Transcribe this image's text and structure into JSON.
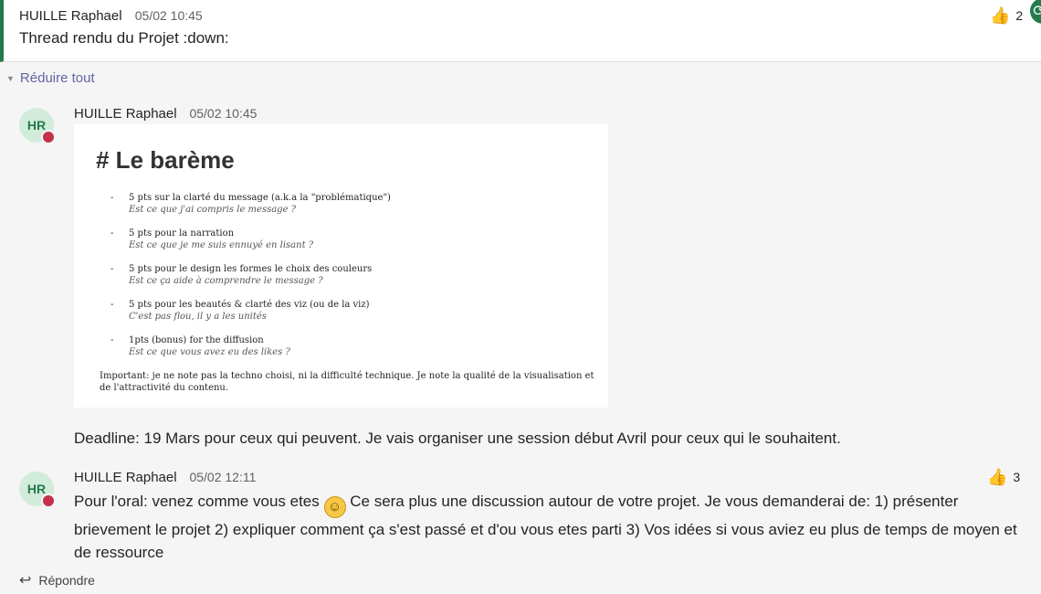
{
  "top_post": {
    "author": "HUILLE Raphael",
    "time": "05/02 10:45",
    "message": "Thread rendu du Projet :down:",
    "reaction_count": "2"
  },
  "collapse_label": "Réduire tout",
  "reply1": {
    "avatar_initials": "HR",
    "author": "HUILLE Raphael",
    "time": "05/02 10:45",
    "image": {
      "title": "# Le barème",
      "items": [
        {
          "main": "5 pts sur la clarté du message (a.k.a la \"problématique\")",
          "sub": "Est ce que j'ai compris le message ?"
        },
        {
          "main": "5 pts  pour la narration",
          "sub": "Est ce que je me suis ennuyé en lisant ?"
        },
        {
          "main": "5 pts pour le design les formes le choix des couleurs",
          "sub": "Est ce ça aide à comprendre le message ?"
        },
        {
          "main": "5 pts pour les beautés & clarté des viz (ou de la viz)",
          "sub": "C'est pas flou, il y a les unités"
        },
        {
          "main": "1pts (bonus) for the diffusion",
          "sub": "Est ce que vous avez eu des likes ?"
        }
      ],
      "note": "Important: je ne note pas la techno choisi, ni la difficulté technique. Je note la qualité de la visualisation et de l'attractivité du contenu."
    },
    "deadline": "Deadline: 19 Mars pour ceux qui peuvent. Je vais organiser une session début Avril pour ceux qui le souhaitent."
  },
  "reply2": {
    "avatar_initials": "HR",
    "author": "HUILLE Raphael",
    "time": "05/02 12:11",
    "reaction_count": "3",
    "text_before": "Pour l'oral: venez comme vous etes",
    "text_after": " Ce sera plus une discussion autour de votre projet. Je vous demanderai de: 1) présenter brievement le projet 2) expliquer comment ça s'est passé et d'ou vous etes parti 3) Vos idées si vous aviez eu plus de temps de moyen et de ressource"
  },
  "reply_button_label": "Répondre",
  "colors": {
    "accent": "#237b4b",
    "link": "#6264a7",
    "presence_busy": "#c4314b"
  },
  "icons": [
    "thumbs-up-icon",
    "grinning-emoji-icon",
    "reply-arrow-icon",
    "collapse-triangle-icon",
    "presence-busy-icon"
  ]
}
